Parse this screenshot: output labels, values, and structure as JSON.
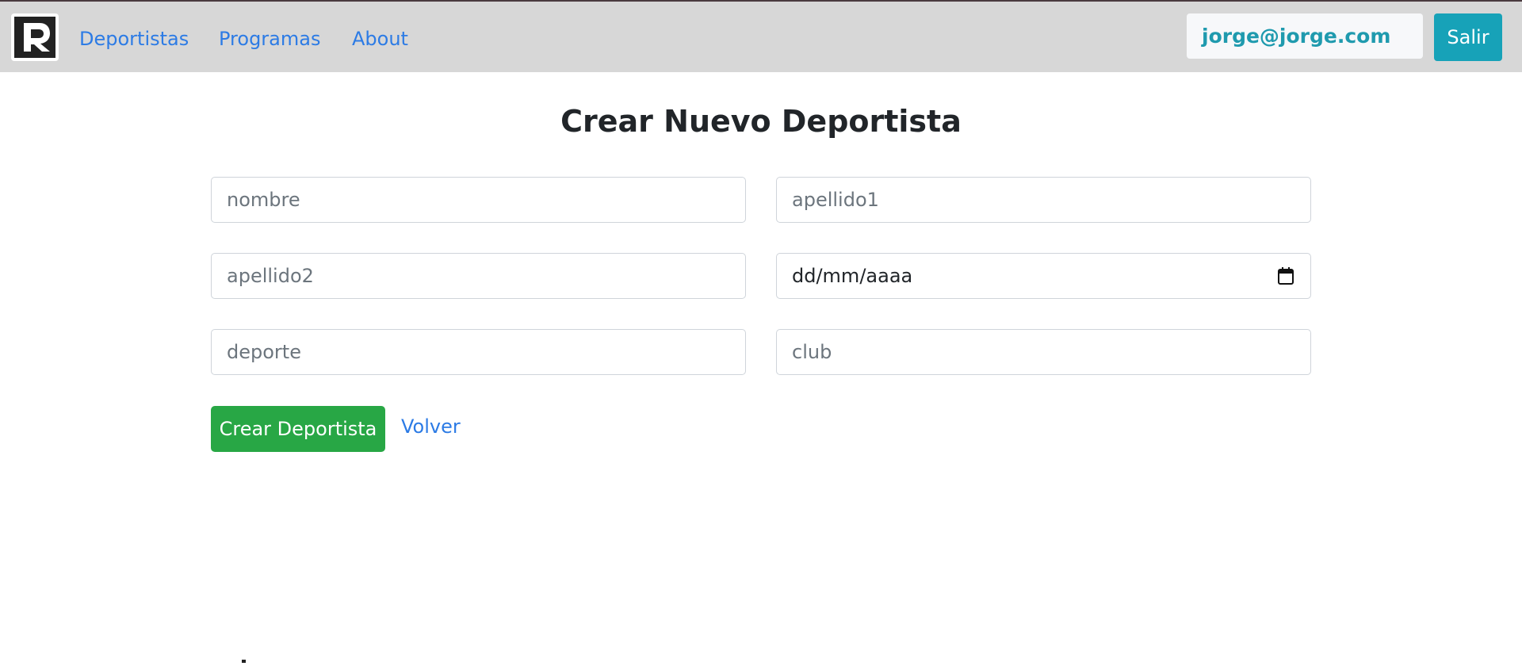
{
  "navbar": {
    "logo_icon": "r-logo-icon",
    "links": [
      {
        "label": "Deportistas"
      },
      {
        "label": "Programas"
      },
      {
        "label": "About"
      }
    ],
    "user_email": "jorge@jorge.com",
    "logout_label": "Salir"
  },
  "main": {
    "title": "Crear Nuevo Deportista",
    "form": {
      "nombre_placeholder": "nombre",
      "apellido1_placeholder": "apellido1",
      "apellido2_placeholder": "apellido2",
      "fecha_placeholder": "dd/mm/aaaa",
      "fecha_icon": "calendar-icon",
      "deporte_placeholder": "deporte",
      "club_placeholder": "club"
    },
    "submit_label": "Crear Deportista",
    "back_label": "Volver"
  },
  "colors": {
    "navbar_bg": "#d7d7d7",
    "link": "#2c7be5",
    "info": "#17a2b8",
    "success": "#28a745"
  }
}
